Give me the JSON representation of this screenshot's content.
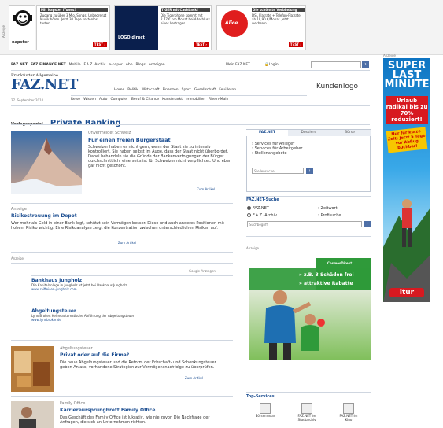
{
  "top_ads": {
    "side_label": "Anzeige",
    "napster_label": "napster",
    "ad1": {
      "title": "Mit Napster iTunes!",
      "text": "Zugang zu über 3 Mio. Songs. Unbegrenzt Musik hören. Jetzt 30 Tage kostenlos testen.",
      "button": "TEST ›"
    },
    "ad2": {
      "title": "TIGER mit Cashback!",
      "text": "Die Tigerphone kommt mit 2.77 € pro Monat bei Abschluss eines Vertrages.",
      "logo": "LOGO direct",
      "button": "TEST ›"
    },
    "ad3": {
      "logo": "Alice",
      "title": "Die schönste Verbindung",
      "text": "DSL Flatrate + Telefon-Flatrate ab 19,90 €/Monat. Jetzt wechseln.",
      "button": "TEST ›"
    }
  },
  "sky": {
    "label": "Anzeige",
    "line1": "SUPER",
    "line2": "LAST",
    "line3": "MINUTE",
    "promo1": "Urlaub radikal bis zu 70% reduziert!",
    "promo2": "Nur für kurze Zeit: Jetzt 5 Tage vor Abflug buchbar!",
    "brand": "ltur"
  },
  "header": {
    "links": [
      "FAZ.NET",
      "FAZ.FINANCE.NET",
      "Mobile",
      "F.A.Z.-Archiv",
      "e-paper",
      "Abo",
      "Blogs",
      "Anzeigen"
    ],
    "my_faz": "Mein FAZ.NET",
    "login": "Login",
    "logo_top": "Frankfurter Allgemeine",
    "logo_main": "FAZ.NET",
    "date": "27. September 2010",
    "nav_row1": [
      "Home",
      "Politik",
      "Wirtschaft",
      "Finanzen",
      "Sport",
      "Gesellschaft",
      "Feuilleton"
    ],
    "nav_row2": [
      "Reise",
      "Wissen",
      "Auto",
      "Computer",
      "Beruf & Chance",
      "Kunstmarkt",
      "Immobilien",
      "Rhein-Main"
    ],
    "kundenlogo": "Kundenlogo"
  },
  "section": {
    "label": "Verlagsspezial",
    "title": "Private Banking"
  },
  "lead": {
    "kicker": "Unvermeidet Schweiz",
    "title": "Für einen freien Bürgerstaat",
    "text": "Schweizer haben es nicht gern, wenn der Staat sie zu intensiv kontrolliert. Sie haben selbst im Auge, dass der Staat nicht überbordet. Dabei behandeln sie die Gründe der Bankenverfolgungen der Bürger durchschnittlich, einerseits ist für Schweizer nicht verpflichtet. Und eben gar nicht geschönt.",
    "more": "Zum Artikel"
  },
  "article2": {
    "kicker": "Anzeige",
    "title": "Risikostreuung im Depot",
    "text": "Wer mehr als Geld in einer Bank legt, schützt sein Vermögen besser. Diese und auch anderes Positionen mit hohem Risiko wichtig: Eine Risikoanalyse zeigt die Konzentration zwischen unterschiedlichen Risiken auf.",
    "more": "Zum Artikel"
  },
  "ads_block": {
    "label": "Anzeige",
    "right": "Google-Anzeigen",
    "items": [
      {
        "title": "Bankhaus Jungholz",
        "text": "Die Kapitalanlage in Jungholz ist jetzt bei Bankhaus Jungholz",
        "url": "www.raiffeisen-jungholz.com"
      },
      {
        "title": "Abgeltungsteuer",
        "text": "Lynx Broker: Keine automatische Abführung der Abgeltungsteuer",
        "url": "www.lynxbroker.de"
      }
    ]
  },
  "article3": {
    "kicker": "Abgeltungsteuer",
    "title": "Privat oder auf die Firma?",
    "text": "Die neue Abgeltungsteuer und die Reform der Erbschaft- und Schenkungsteuer geben Anlass, vorhandene Strategien zur Vermögensnachfolge zu überprüfen.",
    "more": "Zum Artikel"
  },
  "article4": {
    "kicker": "Family Office",
    "title": "Karriereursprungbrett Family Office",
    "text": "Das Geschäft des Family Office ist lukrativ, wie nie zuvor. Die Nachfrage der Anfragen, die sich an Unternehmen richten."
  },
  "sidebar": {
    "tabs": [
      "FAZ.NET",
      "Dossiers",
      "Börse"
    ],
    "list": [
      "Services für Anleger",
      "Services für Arbeitgeber",
      "Stellenangebote"
    ],
    "input_placeholder": "Stellensuche",
    "go": "›",
    "search_title": "FAZ.NET-Suche",
    "radio": [
      "FAZ.NET",
      "F.A.Z.-Archiv",
      "Zeitwort",
      "Profisuche"
    ],
    "search_placeholder": "Suchbegriff",
    "ad_label": "Anzeige",
    "cosmos_brand": "CosmosDirekt",
    "cosmos_b1": "» z.B. 3 Schäden frei",
    "cosmos_b2": "» attraktive Rabatte",
    "topservices_title": "Top-Services",
    "services": [
      "Börsenradar",
      "FAZ.NET im Stadtarchiv",
      "FAZ.NET im Kino"
    ]
  },
  "colors": {
    "brand_blue": "#1c4e91",
    "accent_red": "#cc0000",
    "cosmos_green": "#2f9a3a",
    "sky_blue": "#0e74c2"
  }
}
